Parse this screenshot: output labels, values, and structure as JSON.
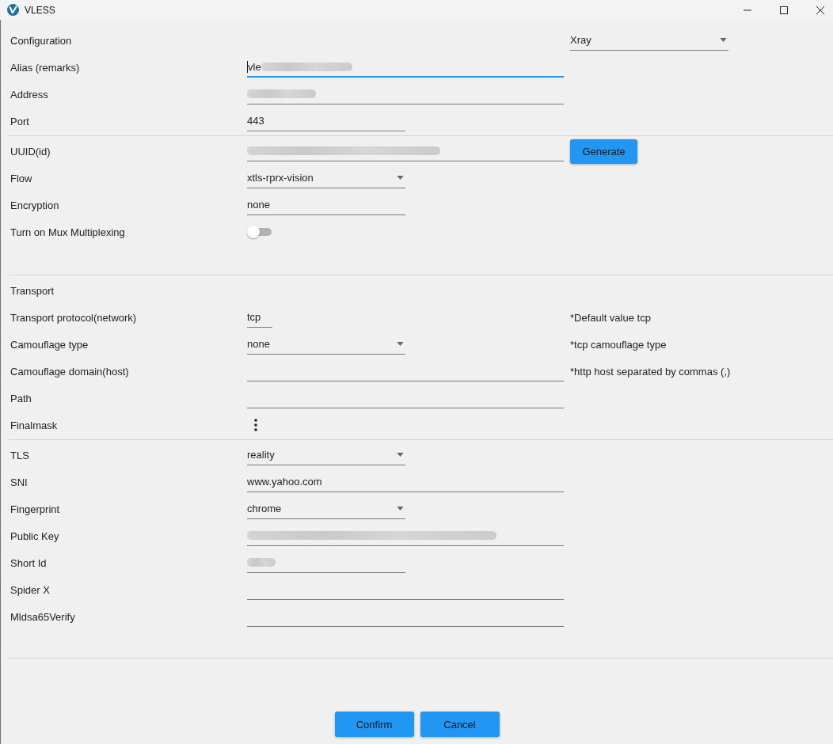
{
  "window": {
    "title": "VLESS"
  },
  "sections": [
    {
      "heading": "Configuration",
      "core_type": {
        "value": "Xray"
      },
      "rows": [
        {
          "kind": "text",
          "label": "Alias (remarks)",
          "value": "vle",
          "focused": true,
          "blurred": true
        },
        {
          "kind": "text",
          "label": "Address",
          "focused": false,
          "blurred": true
        },
        {
          "kind": "text",
          "label": "Port",
          "value": "443",
          "focused": false,
          "blurred": false
        }
      ]
    },
    {
      "rows": [
        {
          "kind": "text",
          "label": "UUID(id)",
          "focused": false,
          "blurred": true,
          "button": "Generate"
        },
        {
          "kind": "dropdown",
          "label": "Flow",
          "value": "xtls-rprx-vision"
        },
        {
          "kind": "text",
          "label": "Encryption",
          "value": "none",
          "focused": false,
          "blurred": false
        },
        {
          "kind": "toggle",
          "label": "Turn on Mux Multiplexing",
          "on": false
        }
      ]
    },
    {
      "heading": "Transport",
      "rows": [
        {
          "kind": "text",
          "label": "Transport protocol(network)",
          "value": "tcp",
          "focused": false,
          "blurred": false,
          "hint": "*Default value tcp"
        },
        {
          "kind": "dropdown",
          "label": "Camouflage type",
          "value": "none",
          "hint": "*tcp camouflage type"
        },
        {
          "kind": "text",
          "label": "Camouflage domain(host)",
          "focused": false,
          "blurred": false,
          "hint": "*http host separated by commas (,)"
        },
        {
          "kind": "text",
          "label": "Path",
          "focused": false,
          "blurred": false
        },
        {
          "kind": "menu",
          "label": "Finalmask"
        }
      ]
    },
    {
      "rows": [
        {
          "kind": "dropdown",
          "label": "TLS",
          "value": "reality"
        },
        {
          "kind": "text",
          "label": "SNI",
          "value": "www.yahoo.com",
          "focused": false,
          "blurred": false
        },
        {
          "kind": "dropdown",
          "label": "Fingerprint",
          "value": "chrome"
        },
        {
          "kind": "text",
          "label": "Public Key",
          "focused": false,
          "blurred": true
        },
        {
          "kind": "text",
          "label": "Short Id",
          "focused": false,
          "blurred": true
        },
        {
          "kind": "text",
          "label": "Spider X",
          "focused": false,
          "blurred": false
        },
        {
          "kind": "text",
          "label": "Mldsa65Verify",
          "focused": false,
          "blurred": false
        }
      ]
    }
  ],
  "buttons": [
    "Confirm",
    "Cancel"
  ]
}
